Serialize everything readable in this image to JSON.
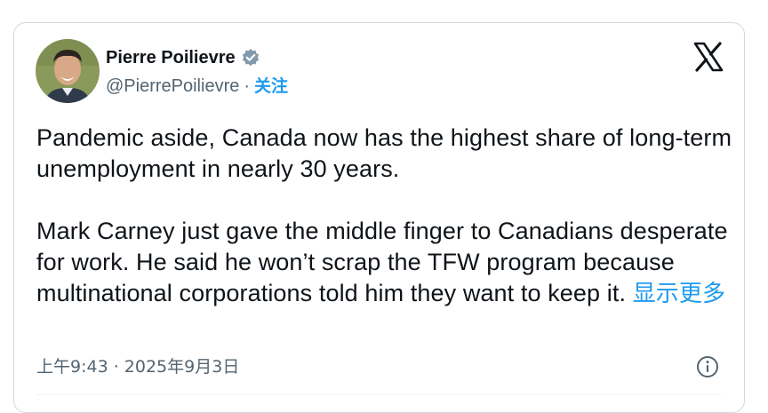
{
  "author": {
    "display_name": "Pierre Poilievre",
    "handle": "@PierrePoilievre",
    "separator": "·",
    "follow_label": "关注",
    "verified": true,
    "avatar_icon": "profile-photo"
  },
  "platform": {
    "logo_icon": "x-logo-icon"
  },
  "tweet": {
    "paragraph_1": "Pandemic aside, Canada now has the highest share of long-term unemployment in nearly 30 years.",
    "paragraph_2": "Mark Carney just gave the middle finger to Canadians desperate for work. He said he won’t scrap the TFW program because multinational corporations told him they want to keep it.",
    "show_more_label": "显示更多"
  },
  "meta": {
    "timestamp": "上午9:43 · 2025年9月3日",
    "info_icon": "info-icon"
  },
  "colors": {
    "accent": "#1d9bf0",
    "text": "#0f1419",
    "muted": "#536471",
    "verified_badge": "#829aab"
  }
}
